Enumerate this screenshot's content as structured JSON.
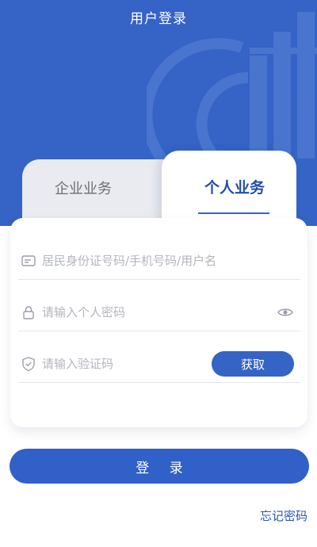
{
  "header": {
    "title": "用户登录"
  },
  "tabs": [
    {
      "label": "企业业务",
      "active": false
    },
    {
      "label": "个人业务",
      "active": true
    }
  ],
  "form": {
    "id_placeholder": "居民身份证号码/手机号码/用户名",
    "password_placeholder": "请输入个人密码",
    "code_placeholder": "请输入验证码",
    "get_code_label": "获取"
  },
  "login_label": "登 录",
  "forgot_label": "忘记密码",
  "colors": {
    "primary": "#3563c6",
    "tab_inactive": "#e9ebf0"
  },
  "icons": [
    "id-card-icon",
    "lock-icon",
    "eye-icon",
    "shield-check-icon",
    "tax-emblem"
  ]
}
